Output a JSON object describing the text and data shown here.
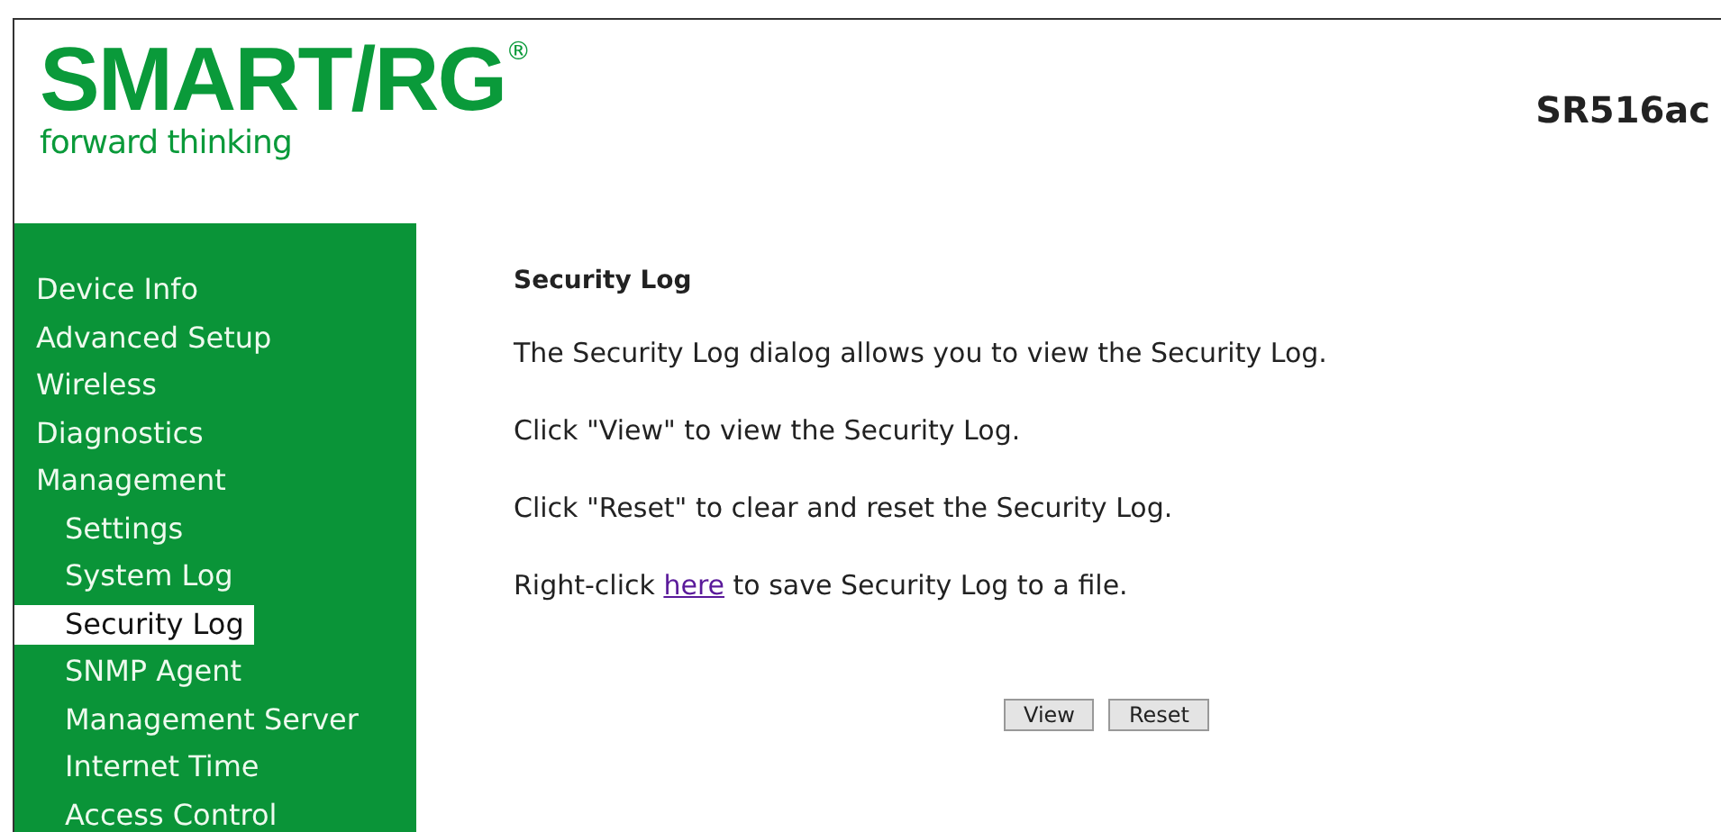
{
  "header": {
    "logo": "SMART/RG",
    "logo_mark": "®",
    "tagline": "forward thinking",
    "model": "SR516ac"
  },
  "sidebar": {
    "items": [
      {
        "label": "Device Info",
        "selected": false
      },
      {
        "label": "Advanced Setup",
        "selected": false
      },
      {
        "label": "Wireless",
        "selected": false
      },
      {
        "label": "Diagnostics",
        "selected": false
      },
      {
        "label": "Management",
        "selected": false,
        "children": [
          {
            "label": "Settings",
            "selected": false
          },
          {
            "label": "System Log",
            "selected": false
          },
          {
            "label": "Security Log",
            "selected": true
          },
          {
            "label": "SNMP Agent",
            "selected": false
          },
          {
            "label": "Management Server",
            "selected": false
          },
          {
            "label": "Internet Time",
            "selected": false
          },
          {
            "label": "Access Control",
            "selected": false
          }
        ]
      }
    ]
  },
  "content": {
    "title": "Security Log",
    "paragraphs": [
      "The Security Log dialog allows you to view the Security Log.",
      "Click \"View\" to view the Security Log.",
      "Click \"Reset\" to clear and reset the Security Log."
    ],
    "link_sentence": {
      "before": "Right-click ",
      "link": "here",
      "after": " to save Security Log to a file."
    },
    "buttons": [
      "View",
      "Reset"
    ]
  }
}
